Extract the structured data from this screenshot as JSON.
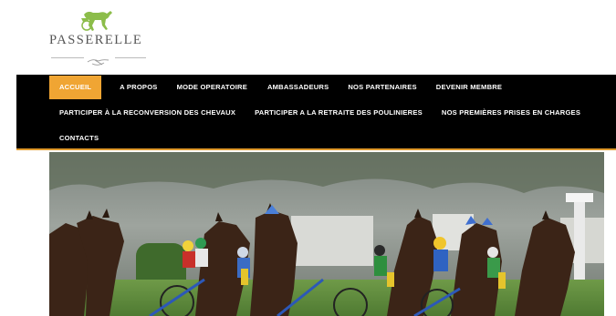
{
  "logo": {
    "brand_text": "PASSERELLE",
    "brand_color": "#555555",
    "horse_color": "#8cbd4a",
    "horse_icon": "trotting-horse-icon",
    "hands_icon": "handshake-icon"
  },
  "nav": {
    "background": "#000000",
    "active_color": "#f0a533",
    "items": [
      {
        "label": "ACCUEIL",
        "active": true
      },
      {
        "label": "A PROPOS"
      },
      {
        "label": "MODE OPERATOIRE"
      },
      {
        "label": "AMBASSADEURS"
      },
      {
        "label": "NOS PARTENAIRES"
      },
      {
        "label": "DEVENIR MEMBRE"
      },
      {
        "label": "PARTICIPER À LA RECONVERSION DES CHEVAUX"
      },
      {
        "label": "PARTICIPER A LA RETRAITE DES POULINIERES"
      },
      {
        "label": "NOS PREMIÈRES PRISES EN CHARGES"
      },
      {
        "label": "CONTACTS"
      }
    ]
  },
  "hero": {
    "subject": "harness racing horses and drivers at the start of a race"
  }
}
